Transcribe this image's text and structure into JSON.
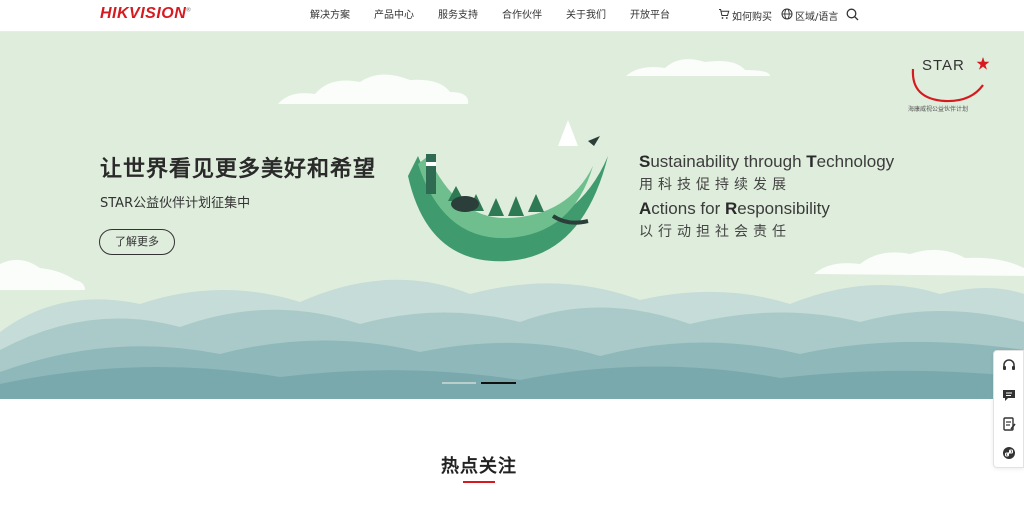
{
  "header": {
    "logo": "HIKVISION",
    "nav": [
      "解决方案",
      "产品中心",
      "服务支持",
      "合作伙伴",
      "关于我们",
      "开放平台"
    ],
    "how_to_buy": "如何购买",
    "region_language": "区域/语言"
  },
  "hero": {
    "title": "让世界看见更多美好和希望",
    "subtitle": "STAR公益伙伴计划征集中",
    "button": "了解更多",
    "en_line1": {
      "cap1": "S",
      "rest1": "ustainability through ",
      "cap2": "T",
      "rest2": "echnology"
    },
    "cn_line1": "用科技促持续发展",
    "en_line2": {
      "cap1": "A",
      "rest1": "ctions for ",
      "cap2": "R",
      "rest2": "esponsibility"
    },
    "cn_line2": "以行动担社会责任",
    "star_logo": "STAR",
    "star_logo_sub": "海康威视公益伙伴计划",
    "carousel": {
      "slides": 2,
      "active_index": 1
    }
  },
  "floating_toolbar": [
    "headset-icon",
    "chat-icon",
    "form-icon",
    "link-icon"
  ],
  "section": {
    "title": "热点关注"
  },
  "colors": {
    "brand_red": "#d71920",
    "hero_background": "#dfeddc",
    "illustration_green": "#3f9a6e"
  }
}
